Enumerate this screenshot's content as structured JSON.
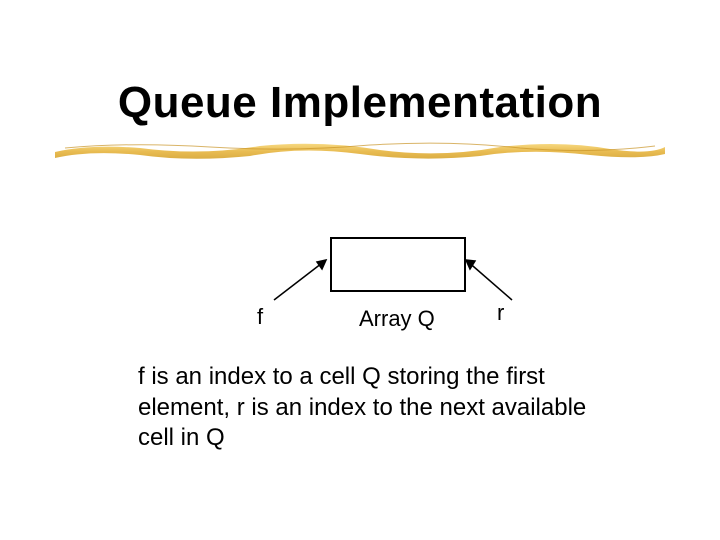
{
  "title": "Queue Implementation",
  "label_f": "f",
  "label_arrayq": "Array Q",
  "label_r": "r",
  "body": "f is an index to a cell Q storing the first element, r is an index to the next available cell in Q"
}
